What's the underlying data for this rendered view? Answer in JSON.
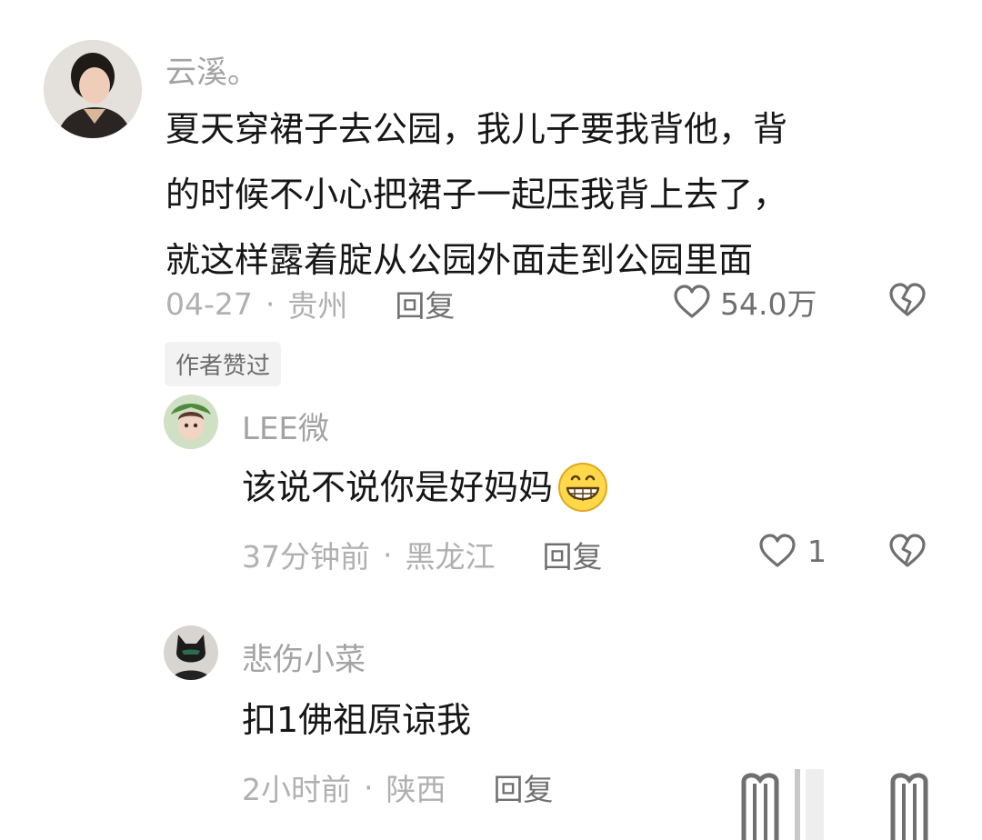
{
  "comments": [
    {
      "author": "云溪。",
      "text_lines": [
        "夏天穿裙子去公园，我儿子要我背他，背",
        "的时候不小心把裙子一起压我背上去了，",
        "就这样露着腚从公园外面走到公园里面"
      ],
      "date": "04-27",
      "sep": "·",
      "location": "贵州",
      "reply_label": "回复",
      "likes": "54.0万",
      "badge": "作者赞过"
    },
    {
      "author": "LEE微",
      "text": "该说不说你是好妈妈",
      "emoji_icon": "grinning-face",
      "date": "37分钟前",
      "sep": "·",
      "location": "黑龙江",
      "reply_label": "回复",
      "likes": "1"
    },
    {
      "author": "悲伤小菜",
      "text": "扣1佛祖原谅我",
      "date": "2小时前",
      "sep": "·",
      "location": "陕西",
      "reply_label": "回复"
    }
  ],
  "colors": {
    "author": "#a3a3a3",
    "text": "#161616",
    "meta": "#b0b0b0",
    "action": "#6f6f6f",
    "badge_bg": "#f2f2f2",
    "background": "#ffffff"
  },
  "icons": [
    "heart-outline-icon",
    "broken-heart-icon",
    "grinning-face-emoji-icon"
  ]
}
